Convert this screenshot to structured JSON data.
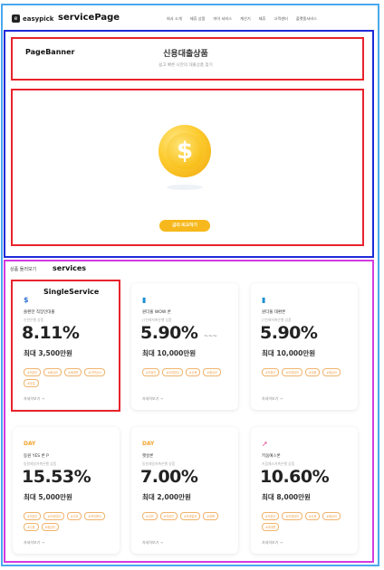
{
  "annotations": {
    "page": "servicePage",
    "banner": "PageBanner",
    "services": "services",
    "single": "SingleService"
  },
  "header": {
    "logo_text": "easypick",
    "nav": [
      "회사 소개",
      "제휴 상품",
      "마이 서비스",
      "계산기",
      "제휴",
      "고객센터",
      "플랫폼서비스"
    ]
  },
  "banner": {
    "title": "신용대출상품",
    "subtitle": "쉽고 빠른 나만의 대출상품 찾기",
    "cta_label": "금리 비교하기"
  },
  "services": {
    "header": "상품 둘러보기",
    "cards": [
      {
        "icon": "shinhan-s-icon",
        "glyph": "$",
        "name": "쏠편한 직장인대출",
        "company": "신한은행 상품",
        "rate": "8.11%",
        "suffix": "",
        "limit": "최대 3,500만원",
        "tags": [
          "#직장인",
          "#중금리",
          "#비대면",
          "#간편심사",
          "#당일"
        ],
        "more": "자세히보기 →"
      },
      {
        "icon": "bank-b-icon",
        "glyph": "▮",
        "name": "원더풀 WOW 론",
        "company": "JT친애저축은행 상품",
        "rate": "5.90%",
        "suffix": "~~~",
        "limit": "최대 10,000만원",
        "tags": [
          "#직장인",
          "#자영업자",
          "#신용",
          "#중금리"
        ],
        "more": "자세히보기 →"
      },
      {
        "icon": "bank-b-icon",
        "glyph": "▮",
        "name": "원더풀 대환론",
        "company": "JT친애저축은행 상품",
        "rate": "5.90%",
        "suffix": "",
        "limit": "최대 10,000만원",
        "tags": [
          "#직장인",
          "#자영업자",
          "#대환",
          "#중금리"
        ],
        "more": "자세히보기 →"
      },
      {
        "icon": "day-logo-icon",
        "glyph": "DAY",
        "name": "동원 YES 론 P",
        "company": "동원제일저축은행 상품",
        "rate": "15.53%",
        "suffix": "",
        "limit": "최대 5,000만원",
        "tags": [
          "#직장인",
          "#자영업자",
          "#주부",
          "#프리랜서",
          "#신용",
          "#중금리"
        ],
        "more": "자세히보기 →"
      },
      {
        "icon": "day-logo-icon",
        "glyph": "DAY",
        "name": "햇살론",
        "company": "동원제일저축은행 상품",
        "rate": "7.00%",
        "suffix": "",
        "limit": "최대 2,000만원",
        "tags": [
          "#서민",
          "#직장인",
          "#자영업자",
          "#정책"
        ],
        "more": "자세히보기 →"
      },
      {
        "icon": "arrow-up-icon",
        "glyph": "➚",
        "name": "키움예스론",
        "company": "키움예스저축은행 상품",
        "rate": "10.60%",
        "suffix": "",
        "limit": "최대 8,000만원",
        "tags": [
          "#직장인",
          "#자영업자",
          "#신용",
          "#중금리",
          "#비대면"
        ],
        "more": "자세히보기 →"
      }
    ]
  },
  "colors": {
    "accent": "#f6b81c",
    "tag": "#f0a046",
    "frame_blue": "#1f2bd8",
    "frame_red": "#e8232b",
    "frame_magenta": "#d23be0",
    "frame_outer": "#4aa8ee"
  }
}
